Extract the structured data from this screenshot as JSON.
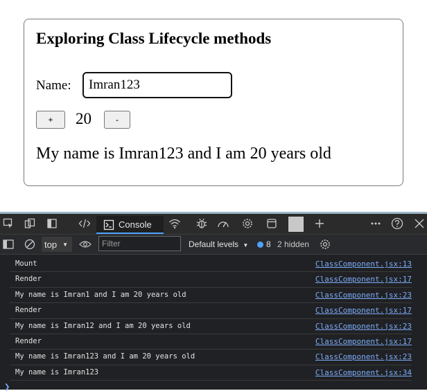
{
  "app": {
    "heading": "Exploring Class Lifecycle methods",
    "name_label": "Name:",
    "name_value": "Imran123",
    "plus_label": "+",
    "age_value": "20",
    "minus_label": "-",
    "message": "My name is Imran123 and I am 20 years old"
  },
  "devtools": {
    "console_tab_label": "Console",
    "context_select": "top",
    "filter_placeholder": "Filter",
    "levels_label": "Default levels",
    "issues_count": "8",
    "hidden_label": "2 hidden",
    "accent_color": "#4da3ff",
    "logs": [
      {
        "message": "Mount",
        "source": "ClassComponent.jsx:13"
      },
      {
        "message": "Render",
        "source": "ClassComponent.jsx:17"
      },
      {
        "message": "My name is Imran1 and I am 20 years old",
        "source": "ClassComponent.jsx:23"
      },
      {
        "message": "Render",
        "source": "ClassComponent.jsx:17"
      },
      {
        "message": "My name is Imran12 and I am 20 years old",
        "source": "ClassComponent.jsx:23"
      },
      {
        "message": "Render",
        "source": "ClassComponent.jsx:17"
      },
      {
        "message": "My name is Imran123 and I am 20 years old",
        "source": "ClassComponent.jsx:23"
      },
      {
        "message": "My name is Imran123",
        "source": "ClassComponent.jsx:34"
      }
    ]
  }
}
